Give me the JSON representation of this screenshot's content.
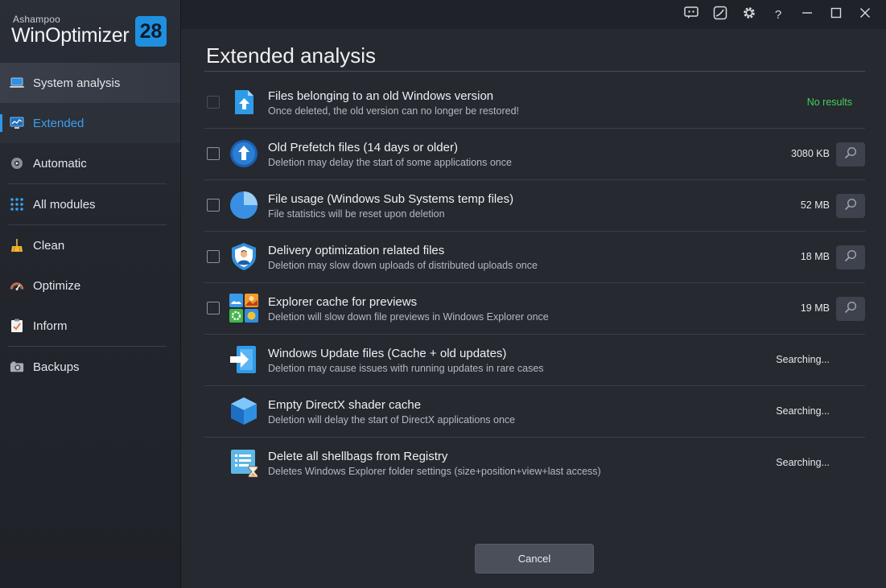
{
  "app": {
    "vendor": "Ashampoo",
    "product": "WinOptimizer",
    "version": "28"
  },
  "sidebar": {
    "items": [
      {
        "label": "System analysis",
        "icon": "laptop-icon"
      },
      {
        "label": "Extended",
        "icon": "monitor-chart-icon",
        "active": true
      },
      {
        "label": "Automatic",
        "icon": "gear-play-icon"
      },
      {
        "label": "All modules",
        "icon": "grid-icon"
      },
      {
        "label": "Clean",
        "icon": "broom-icon"
      },
      {
        "label": "Optimize",
        "icon": "speedometer-icon"
      },
      {
        "label": "Inform",
        "icon": "clipboard-check-icon"
      },
      {
        "label": "Backups",
        "icon": "camera-icon"
      }
    ]
  },
  "titlebar": {
    "icons": [
      "feedback-icon",
      "skin-icon",
      "settings-icon",
      "help-icon",
      "minimize-icon",
      "maximize-icon",
      "close-icon"
    ],
    "help_glyph": "?"
  },
  "main": {
    "title": "Extended analysis",
    "rows": [
      {
        "title": "Files belonging to an old Windows version",
        "subtitle": "Once deleted, the old version can no longer be restored!",
        "status": "No results",
        "checkbox": "disabled",
        "icon": "file-upload-icon"
      },
      {
        "title": "Old Prefetch files (14 days or older)",
        "subtitle": "Deletion may delay the start of some applications once",
        "status": "3080 KB",
        "checkbox": "enabled",
        "icon": "upload-circle-icon"
      },
      {
        "title": "File usage (Windows Sub Systems temp files)",
        "subtitle": "File statistics will be reset upon deletion",
        "status": "52 MB",
        "checkbox": "enabled",
        "icon": "pie-chart-icon"
      },
      {
        "title": "Delivery optimization related files",
        "subtitle": "Deletion may slow down uploads of distributed uploads once",
        "status": "18 MB",
        "checkbox": "enabled",
        "icon": "shield-user-icon"
      },
      {
        "title": "Explorer cache for previews",
        "subtitle": "Deletion will slow down file previews in Windows Explorer once",
        "status": "19 MB",
        "checkbox": "enabled",
        "icon": "image-tiles-icon"
      },
      {
        "title": "Windows Update files (Cache + old updates)",
        "subtitle": "Deletion may cause issues with running updates in rare cases",
        "status": "Searching...",
        "checkbox": "none",
        "icon": "arrow-into-file-icon"
      },
      {
        "title": "Empty DirectX shader cache",
        "subtitle": "Deletion will delay the start of DirectX applications once",
        "status": "Searching...",
        "checkbox": "none",
        "icon": "cube-icon"
      },
      {
        "title": "Delete all shellbags from Registry",
        "subtitle": "Deletes Windows Explorer folder settings (size+position+view+last access)",
        "status": "Searching...",
        "checkbox": "none",
        "icon": "registry-hourglass-icon"
      }
    ],
    "cancel_label": "Cancel"
  },
  "colors": {
    "accent": "#2f96ea",
    "no_results": "#44d05a"
  }
}
